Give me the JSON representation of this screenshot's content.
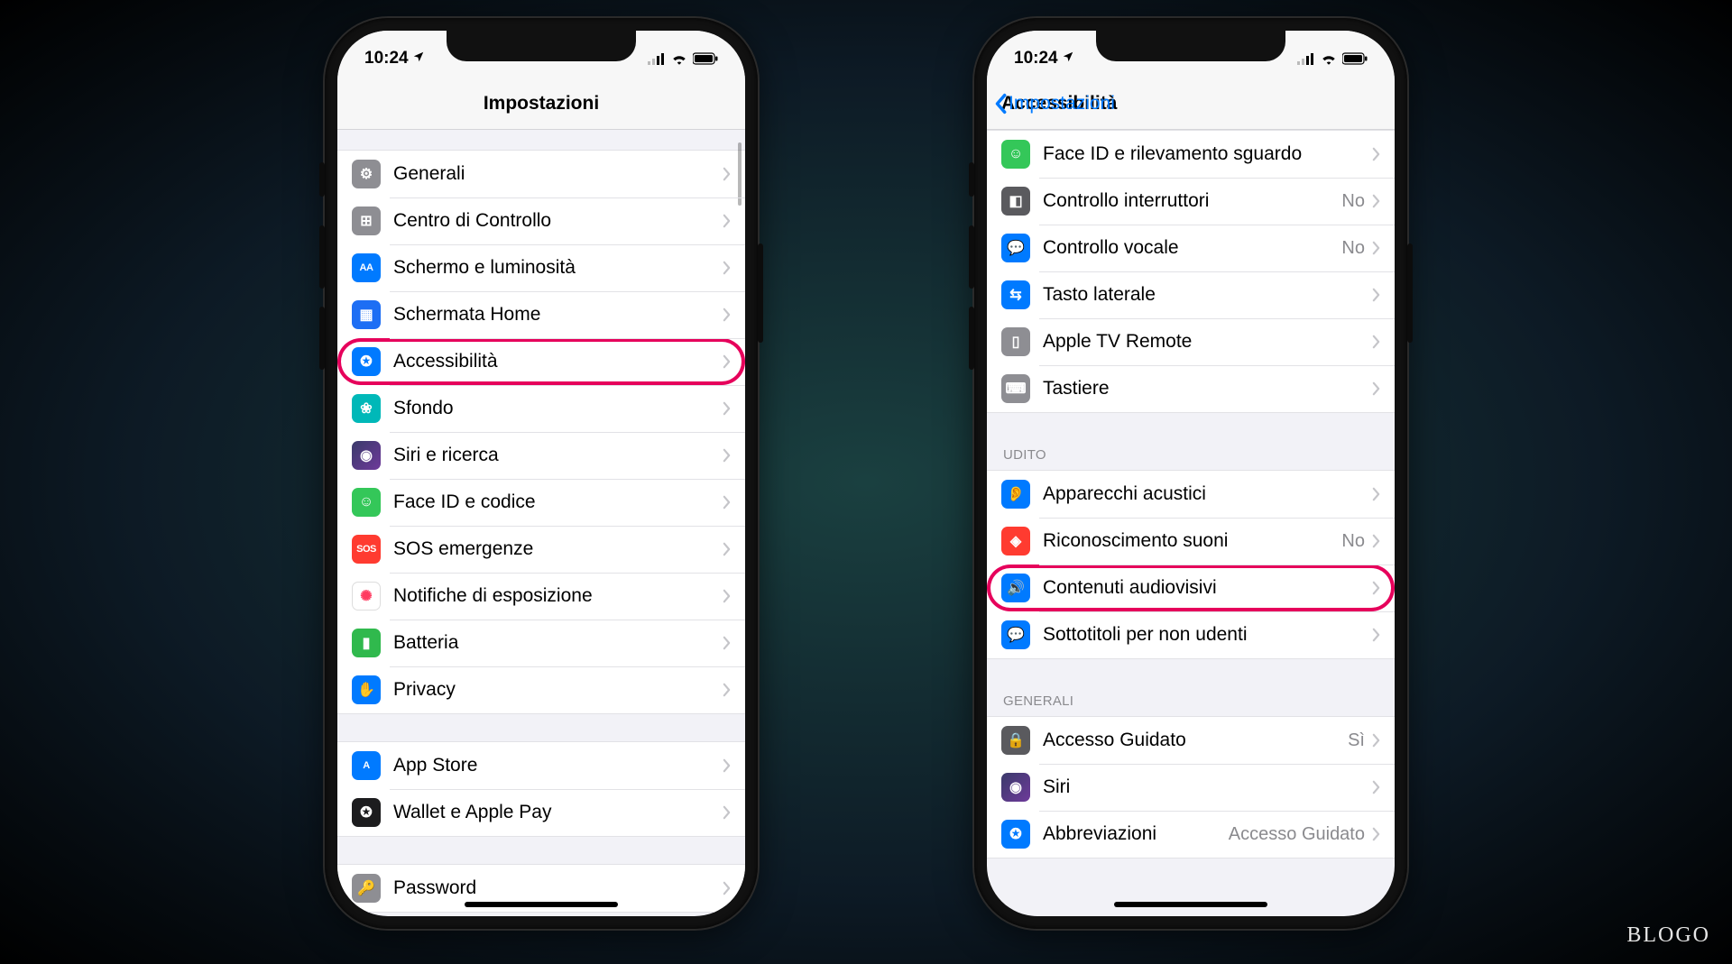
{
  "watermark": "BLOGO",
  "phone1": {
    "time": "10:24",
    "title": "Impostazioni",
    "groups": [
      {
        "header": "",
        "rows": [
          {
            "icon": {
              "bg": "bg-gray",
              "glyph": "⚙"
            },
            "name": "row-generali",
            "label": "Generali"
          },
          {
            "icon": {
              "bg": "bg-gray",
              "glyph": "⊞"
            },
            "name": "row-centro-controllo",
            "label": "Centro di Controllo"
          },
          {
            "icon": {
              "bg": "bg-blue",
              "glyph": "AA",
              "txt": true
            },
            "name": "row-schermo",
            "label": "Schermo e luminosità"
          },
          {
            "icon": {
              "bg": "bg-blue2",
              "glyph": "▦"
            },
            "name": "row-schermata-home",
            "label": "Schermata Home"
          },
          {
            "icon": {
              "bg": "bg-blue",
              "glyph": "✪"
            },
            "name": "row-accessibilita",
            "label": "Accessibilità",
            "highlight": true
          },
          {
            "icon": {
              "bg": "bg-teal",
              "glyph": "❀"
            },
            "name": "row-sfondo",
            "label": "Sfondo"
          },
          {
            "icon": {
              "bg": "bg-purple",
              "glyph": "◉"
            },
            "name": "row-siri-ricerca",
            "label": "Siri e ricerca"
          },
          {
            "icon": {
              "bg": "bg-green",
              "glyph": "☺"
            },
            "name": "row-faceid",
            "label": "Face ID e codice"
          },
          {
            "icon": {
              "bg": "bg-red",
              "glyph": "SOS",
              "txt": true
            },
            "name": "row-sos",
            "label": "SOS emergenze"
          },
          {
            "icon": {
              "bg": "bg-white",
              "glyph": "✺",
              "fg": "#ff3b60"
            },
            "name": "row-notifiche-esposizione",
            "label": "Notifiche di esposizione"
          },
          {
            "icon": {
              "bg": "bg-green2",
              "glyph": "▮"
            },
            "name": "row-batteria",
            "label": "Batteria"
          },
          {
            "icon": {
              "bg": "bg-blue",
              "glyph": "✋"
            },
            "name": "row-privacy",
            "label": "Privacy"
          }
        ]
      },
      {
        "header": "",
        "rows": [
          {
            "icon": {
              "bg": "bg-blue",
              "glyph": "A",
              "txt": true
            },
            "name": "row-appstore",
            "label": "App Store"
          },
          {
            "icon": {
              "bg": "bg-black",
              "glyph": "✪"
            },
            "name": "row-wallet",
            "label": "Wallet e Apple Pay"
          }
        ]
      },
      {
        "header": "",
        "rows": [
          {
            "icon": {
              "bg": "bg-gray",
              "glyph": "🔑"
            },
            "name": "row-password",
            "label": "Password"
          }
        ]
      }
    ]
  },
  "phone2": {
    "time": "10:24",
    "back": "Impostazioni",
    "title": "Accessibilità",
    "groups": [
      {
        "header": "",
        "rows": [
          {
            "icon": {
              "bg": "bg-green",
              "glyph": "☺"
            },
            "name": "row-faceid-sguardo",
            "label": "Face ID e rilevamento sguardo"
          },
          {
            "icon": {
              "bg": "bg-dkgray",
              "glyph": "◧"
            },
            "name": "row-controllo-interruttori",
            "label": "Controllo interruttori",
            "value": "No"
          },
          {
            "icon": {
              "bg": "bg-blue",
              "glyph": "💬"
            },
            "name": "row-controllo-vocale",
            "label": "Controllo vocale",
            "value": "No"
          },
          {
            "icon": {
              "bg": "bg-blue",
              "glyph": "⇆"
            },
            "name": "row-tasto-laterale",
            "label": "Tasto laterale"
          },
          {
            "icon": {
              "bg": "bg-gray",
              "glyph": "▯"
            },
            "name": "row-apple-tv-remote",
            "label": "Apple TV Remote"
          },
          {
            "icon": {
              "bg": "bg-gray",
              "glyph": "⌨"
            },
            "name": "row-tastiere",
            "label": "Tastiere"
          }
        ]
      },
      {
        "header": "UDITO",
        "rows": [
          {
            "icon": {
              "bg": "bg-blue",
              "glyph": "👂"
            },
            "name": "row-apparecchi-acustici",
            "label": "Apparecchi acustici"
          },
          {
            "icon": {
              "bg": "bg-red",
              "glyph": "◈"
            },
            "name": "row-riconoscimento-suoni",
            "label": "Riconoscimento suoni",
            "value": "No"
          },
          {
            "icon": {
              "bg": "bg-blue",
              "glyph": "🔊"
            },
            "name": "row-contenuti-audiovisivi",
            "label": "Contenuti audiovisivi",
            "highlight": true
          },
          {
            "icon": {
              "bg": "bg-blue",
              "glyph": "💬"
            },
            "name": "row-sottotitoli",
            "label": "Sottotitoli per non udenti"
          }
        ]
      },
      {
        "header": "GENERALI",
        "rows": [
          {
            "icon": {
              "bg": "bg-dkgray",
              "glyph": "🔒"
            },
            "name": "row-accesso-guidato",
            "label": "Accesso Guidato",
            "value": "Sì"
          },
          {
            "icon": {
              "bg": "bg-purple",
              "glyph": "◉"
            },
            "name": "row-siri",
            "label": "Siri"
          },
          {
            "icon": {
              "bg": "bg-blue",
              "glyph": "✪"
            },
            "name": "row-abbreviazioni",
            "label": "Abbreviazioni",
            "value": "Accesso Guidato"
          }
        ]
      }
    ]
  }
}
